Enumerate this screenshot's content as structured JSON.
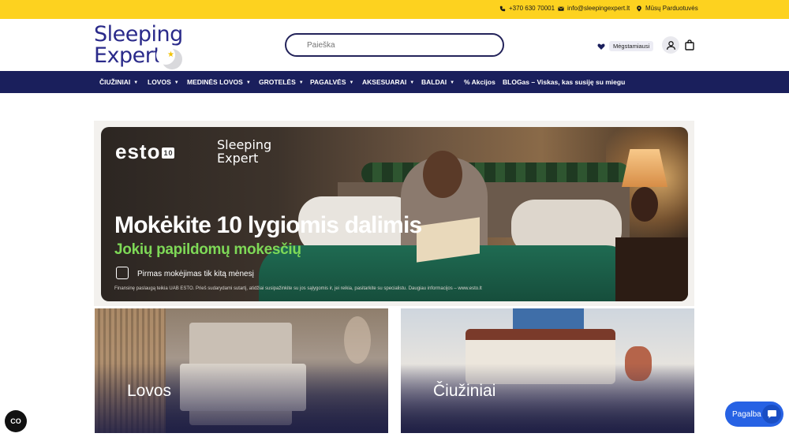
{
  "topbar": {
    "phone": "+370 630 70001",
    "email": "info@sleepingexpert.lt",
    "stores": "Mūsų Parduotuvės"
  },
  "header": {
    "logo_line1": "Sleeping",
    "logo_line2": "Expert",
    "search_placeholder": "Paieška",
    "favorites_label": "Mėgstamiausi"
  },
  "nav": {
    "items": [
      {
        "label": "ČIUŽINIAI",
        "has_dropdown": true
      },
      {
        "label": "LOVOS",
        "has_dropdown": true
      },
      {
        "label": "MEDINĖS LOVOS",
        "has_dropdown": true
      },
      {
        "label": "GROTELĖS",
        "has_dropdown": true
      },
      {
        "label": "PAGALVĖS",
        "has_dropdown": true
      },
      {
        "label": "AKSESUARAI",
        "has_dropdown": true
      },
      {
        "label": "BALDAI",
        "has_dropdown": true
      },
      {
        "label": "% Akcijos",
        "has_dropdown": false
      },
      {
        "label": "BLOGas – Viskas, kas susiję su miegu",
        "has_dropdown": false
      }
    ]
  },
  "banner": {
    "partner_logo": "esto",
    "partner_logo_badge": "10",
    "brand_line1": "Sleeping",
    "brand_line2": "Expert",
    "headline": "Mokėkite 10 lygiomis dalimis",
    "subheadline": "Jokių papildomų mokesčių",
    "note": "Pirmas mokėjimas tik kitą mėnesį",
    "fine_print": "Finansinę paslaugą teikia UAB ESTO. Prieš sudarydami sutartį, atidžiai susipažinkite su jos sąlygomis ir, jei reikia, pasitarkite su specialistu. Daugiau informacijos – www.esto.lt"
  },
  "categories": [
    {
      "label": "Lovos"
    },
    {
      "label": "Čiužiniai"
    }
  ],
  "widgets": {
    "accessibility_label": "CO",
    "help_label": "Pagalba"
  },
  "colors": {
    "topbar": "#fdd21f",
    "nav": "#1a1f5c",
    "brand_blue": "#2a2a8a",
    "accent_green": "#7ed957",
    "help_button": "#2762e4"
  }
}
